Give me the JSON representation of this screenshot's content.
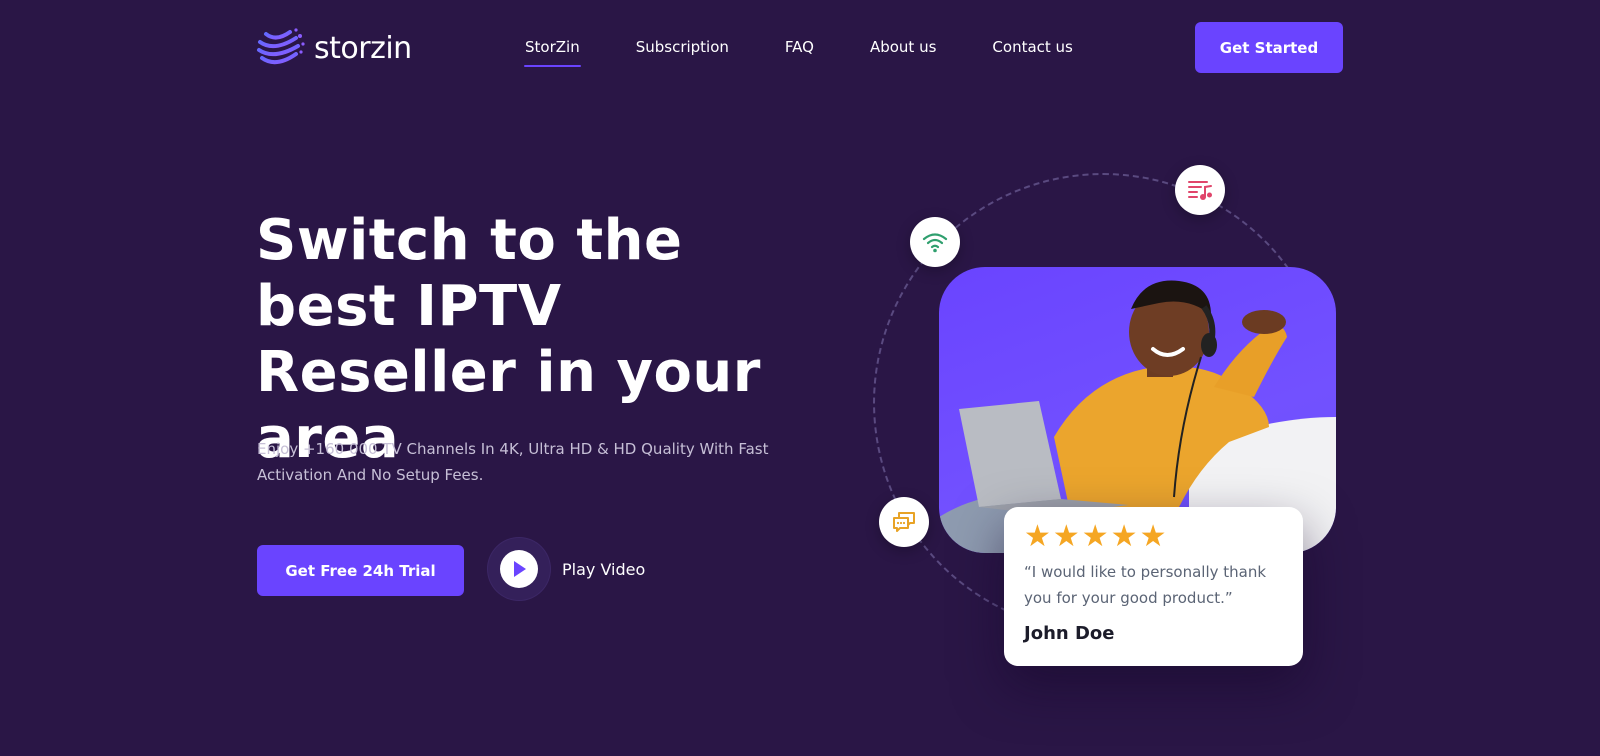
{
  "brand": {
    "name": "storzin",
    "accent": "#6a44ff",
    "background": "#2a1646"
  },
  "nav": {
    "items": [
      {
        "label": "StorZin",
        "active": true
      },
      {
        "label": "Subscription"
      },
      {
        "label": "FAQ"
      },
      {
        "label": "About us"
      },
      {
        "label": "Contact us"
      }
    ],
    "cta_label": "Get Started"
  },
  "hero": {
    "title": "Switch to the best IPTV Reseller in your area",
    "subtitle": "Enjoy +160 000 TV Channels In 4K, Ultra HD & HD Quality With Fast Activation And No Setup Fees.",
    "trial_label": "Get Free 24h Trial",
    "play_label": "Play Video"
  },
  "visual": {
    "icons": [
      "playlist-music-icon",
      "wifi-icon",
      "chat-bubbles-icon"
    ],
    "photo": "person-with-laptop-headphones"
  },
  "review": {
    "rating": 5,
    "stars": "★★★★★",
    "quote": "“I would like to personally thank you for your good product.”",
    "author": "John Doe"
  }
}
